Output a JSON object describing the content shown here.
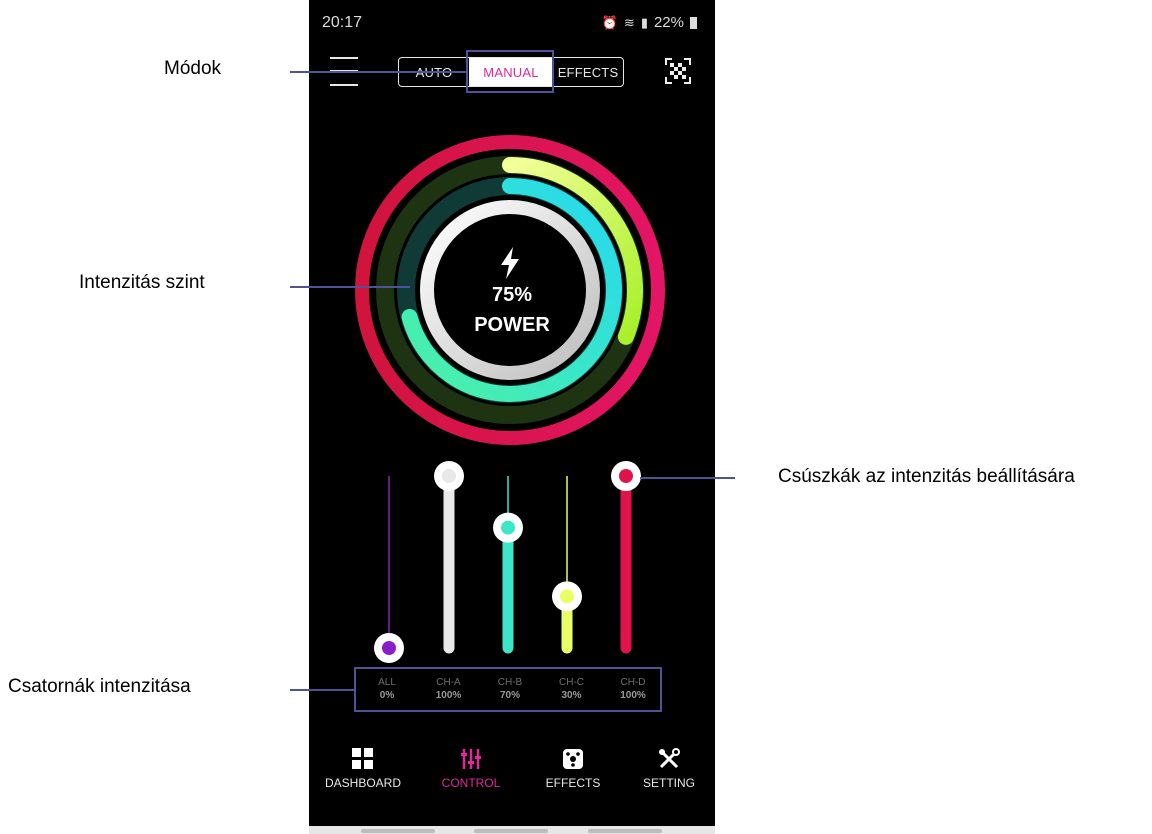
{
  "status_bar": {
    "time": "20:17",
    "battery": "22%"
  },
  "modes": {
    "auto": "AUTO",
    "manual": "MANUAL",
    "effects": "EFFECTS",
    "active": "MANUAL"
  },
  "power": {
    "value": "75%",
    "label": "POWER",
    "level": 0.75
  },
  "rings": {
    "outer_color": "#d0143c",
    "ch_a_color": "#f0f0f0",
    "ch_b_color": "#3ff0c0",
    "ch_c_color": "#e8ff70",
    "ch_d_color": "#d0143c"
  },
  "channels": [
    {
      "name": "ALL",
      "value": "0%",
      "level": 0.0,
      "color": "#8a1fc9"
    },
    {
      "name": "CH-A",
      "value": "100%",
      "level": 1.0,
      "color": "#e8e8e8"
    },
    {
      "name": "CH-B",
      "value": "70%",
      "level": 0.7,
      "color": "#3ee6c9"
    },
    {
      "name": "CH-C",
      "value": "30%",
      "level": 0.3,
      "color": "#eaff66"
    },
    {
      "name": "CH-D",
      "value": "100%",
      "level": 1.0,
      "color": "#e0144a"
    }
  ],
  "bottom_nav": {
    "dashboard": "DASHBOARD",
    "control": "CONTROL",
    "effects": "EFFECTS",
    "setting": "SETTING",
    "active": "CONTROL",
    "active_color": "#e0279c"
  },
  "annotations": {
    "modes": "Módok",
    "intensity_level": "Intenzitás szint",
    "sliders": "Csúszkák az intenzitás beállítására",
    "channel_intensity": "Csatornák intenzitása",
    "line_color": "#4f5296"
  }
}
